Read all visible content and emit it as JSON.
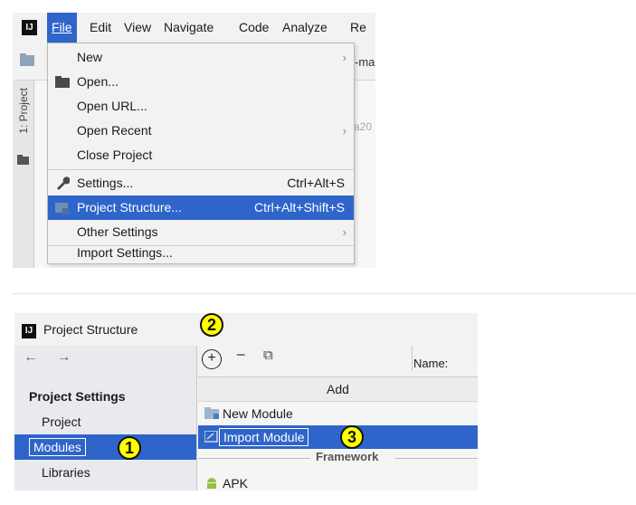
{
  "menubar": {
    "items": [
      "File",
      "Edit",
      "View",
      "Navigate",
      "Code",
      "Analyze",
      "Re"
    ],
    "active": "File"
  },
  "ide": {
    "side_label": "1: Project",
    "editor_fragments": [
      "-ma",
      "a20"
    ]
  },
  "file_menu": {
    "items": [
      {
        "label": "New",
        "shortcut": "",
        "submenu": true,
        "icon": ""
      },
      {
        "label": "Open...",
        "shortcut": "",
        "submenu": false,
        "icon": "folder-icon"
      },
      {
        "label": "Open URL...",
        "shortcut": "",
        "submenu": false,
        "icon": ""
      },
      {
        "label": "Open Recent",
        "shortcut": "",
        "submenu": true,
        "icon": ""
      },
      {
        "label": "Close Project",
        "shortcut": "",
        "submenu": false,
        "icon": ""
      },
      {
        "label": "Settings...",
        "shortcut": "Ctrl+Alt+S",
        "submenu": false,
        "icon": "wrench-icon"
      },
      {
        "label": "Project Structure...",
        "shortcut": "Ctrl+Alt+Shift+S",
        "submenu": false,
        "icon": "project-structure-icon",
        "selected": true
      },
      {
        "label": "Other Settings",
        "shortcut": "",
        "submenu": true,
        "icon": ""
      },
      {
        "label": "Import Settings...",
        "shortcut": "",
        "submenu": false,
        "icon": ""
      }
    ]
  },
  "project_structure": {
    "title": "Project Structure",
    "nav_arrows": "← →",
    "section_heading": "Project Settings",
    "items": [
      "Project",
      "Modules",
      "Libraries"
    ],
    "selected": "Modules",
    "toolbar": {
      "add": "+",
      "remove": "−",
      "copy": "⧉"
    },
    "name_column": "Name:",
    "add_popup": {
      "title": "Add",
      "items": [
        "New Module",
        "Import Module",
        "APK"
      ],
      "selected": "Import Module",
      "group_label": "Framework"
    },
    "markers": [
      "1",
      "2",
      "3"
    ]
  },
  "colors": {
    "selection": "#2f65ca",
    "marker": "#ffff00"
  }
}
